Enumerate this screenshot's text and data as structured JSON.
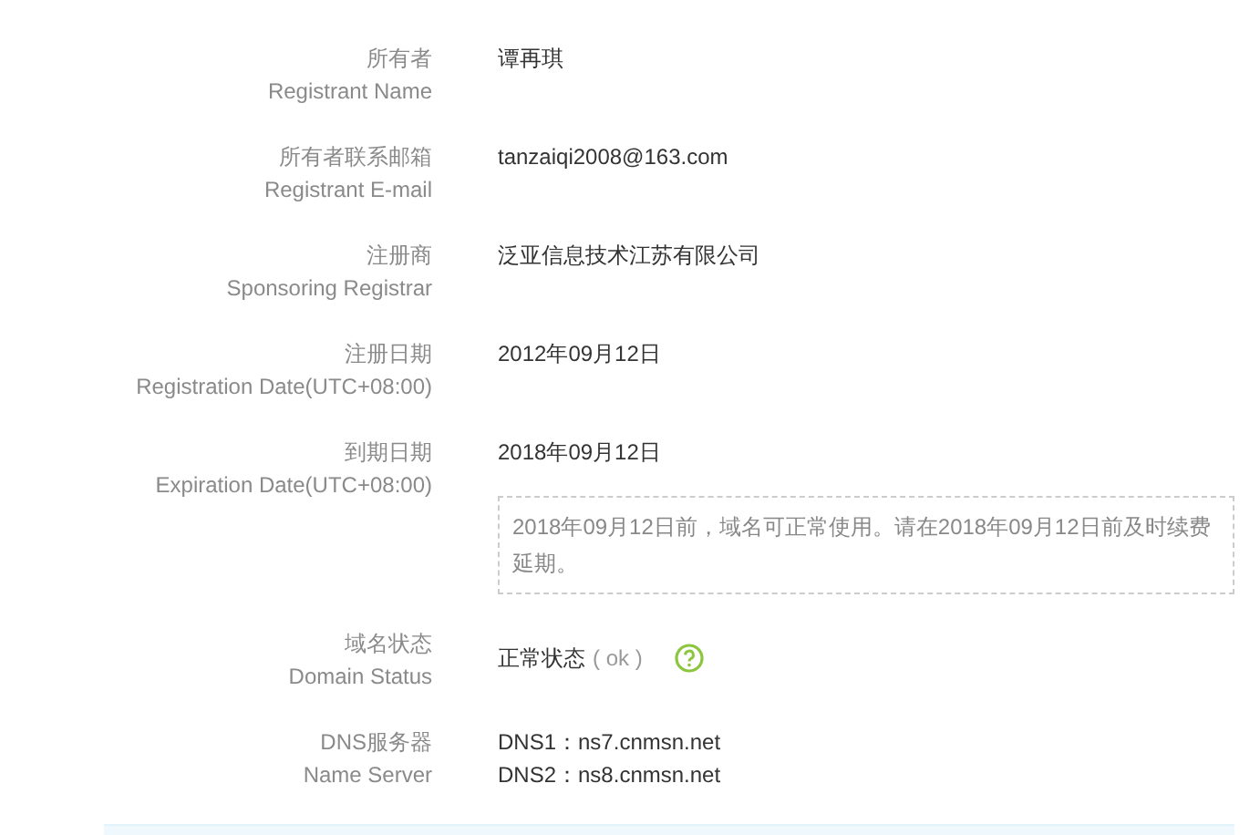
{
  "rows": [
    {
      "kind": "text",
      "label": "所有者",
      "sublabel": "Registrant Name",
      "values": [
        "谭再琪"
      ]
    },
    {
      "kind": "text",
      "label": "所有者联系邮箱",
      "sublabel": "Registrant E-mail",
      "values": [
        "tanzaiqi2008@163.com"
      ]
    },
    {
      "kind": "text",
      "label": "注册商",
      "sublabel": "Sponsoring Registrar",
      "values": [
        "泛亚信息技术江苏有限公司"
      ]
    },
    {
      "kind": "text",
      "label": "注册日期",
      "sublabel": "Registration Date(UTC+08:00)",
      "values": [
        "2012年09月12日"
      ]
    },
    {
      "kind": "text",
      "label": "到期日期",
      "sublabel": "Expiration Date(UTC+08:00)",
      "values": [
        "2018年09月12日"
      ],
      "note": "2018年09月12日前，域名可正常使用。请在2018年09月12日前及时续费延期。"
    },
    {
      "kind": "status",
      "label": "域名状态",
      "sublabel": "Domain Status",
      "values": [
        "正常状态"
      ],
      "status_code": "( ok )"
    },
    {
      "kind": "text",
      "label": "DNS服务器",
      "sublabel": "Name Server",
      "values": [
        "DNS1：ns7.cnmsn.net",
        "DNS2：ns8.cnmsn.net"
      ]
    }
  ]
}
